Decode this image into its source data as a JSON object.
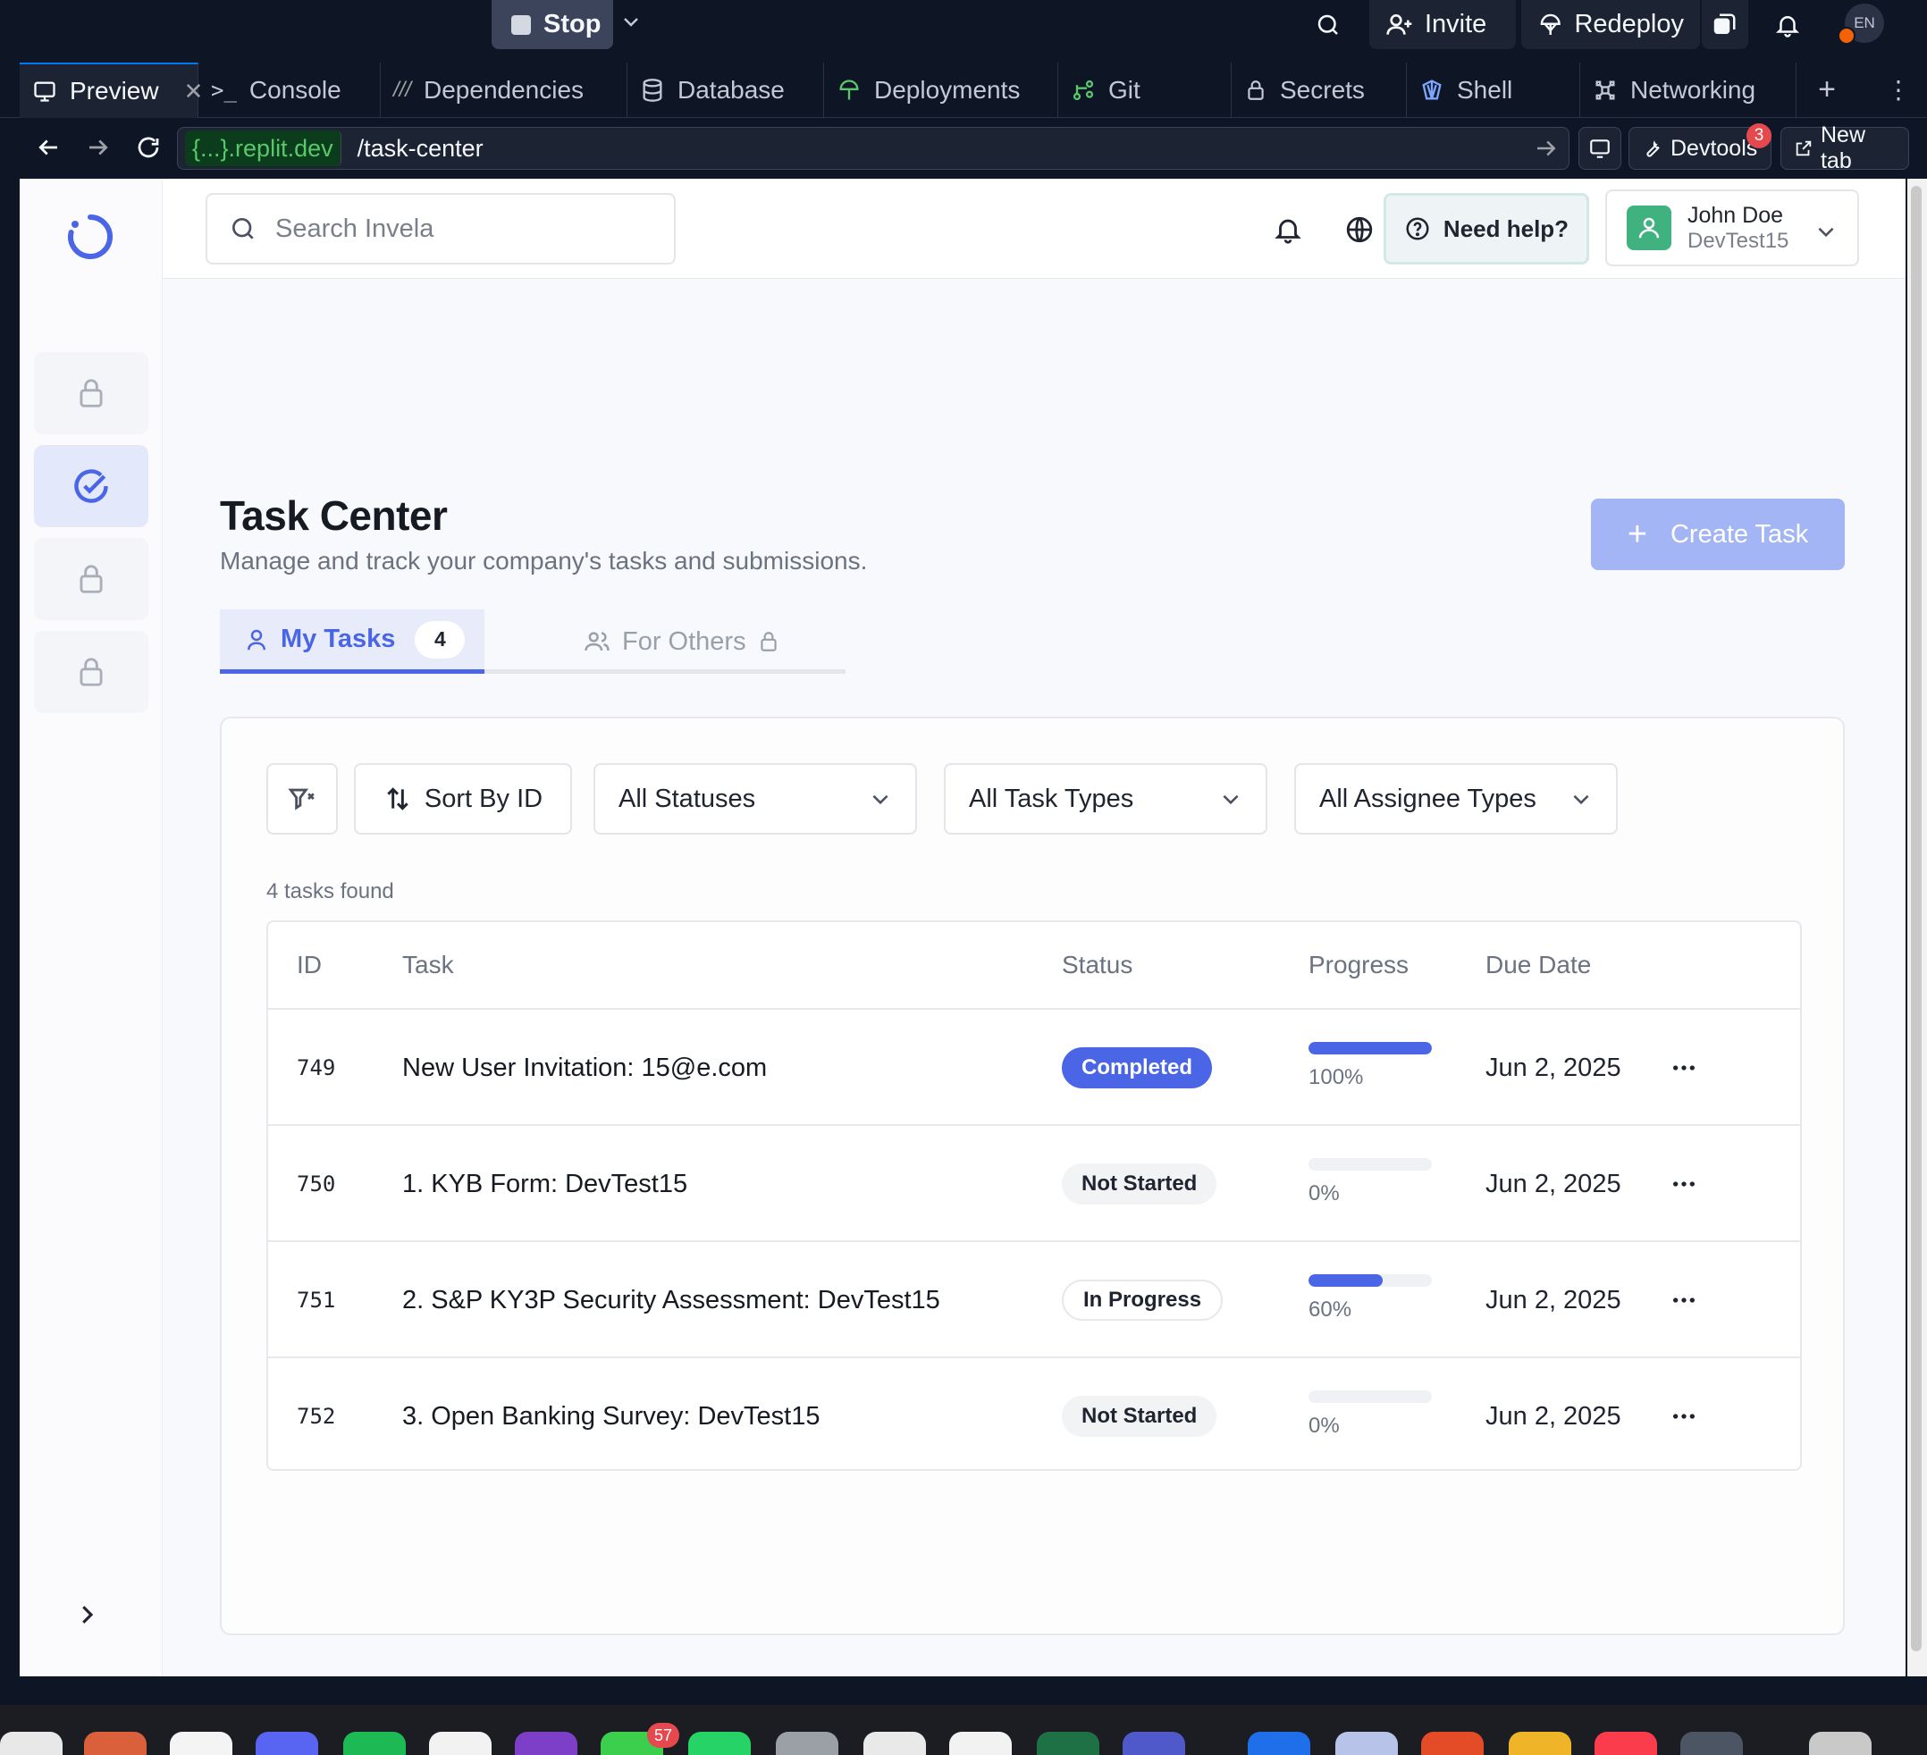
{
  "replit": {
    "stop_label": "Stop",
    "invite_label": "Invite",
    "redeploy_label": "Redeploy",
    "avatar_initials": "EN",
    "tabs": [
      {
        "label": "Preview",
        "icon": "monitor-icon",
        "active": true
      },
      {
        "label": "Console",
        "icon": "terminal-icon"
      },
      {
        "label": "Dependencies",
        "icon": "dependencies-icon"
      },
      {
        "label": "Database",
        "icon": "database-icon"
      },
      {
        "label": "Deployments",
        "icon": "deployments-icon"
      },
      {
        "label": "Git",
        "icon": "git-icon"
      },
      {
        "label": "Secrets",
        "icon": "lock-icon"
      },
      {
        "label": "Shell",
        "icon": "shell-icon"
      },
      {
        "label": "Networking",
        "icon": "networking-icon"
      }
    ],
    "url_host": "{...}.replit.dev",
    "url_path": "/task-center",
    "devtools_label": "Devtools",
    "devtools_badge": "3",
    "newtab_label": "New tab",
    "dock_badge": "57"
  },
  "header": {
    "search_placeholder": "Search Invela",
    "help_label": "Need help?",
    "user_name": "John Doe",
    "user_org": "DevTest15"
  },
  "page": {
    "title": "Task Center",
    "subtitle": "Manage and track your company's tasks and submissions.",
    "create_label": "Create Task",
    "tab_my_label": "My Tasks",
    "tab_my_count": "4",
    "tab_others_label": "For Others"
  },
  "filters": {
    "sort_label": "Sort By ID",
    "status_select": "All Statuses",
    "type_select": "All Task Types",
    "assignee_select": "All Assignee Types",
    "found_text": "4 tasks found"
  },
  "table": {
    "columns": {
      "id": "ID",
      "task": "Task",
      "status": "Status",
      "progress": "Progress",
      "due": "Due Date"
    },
    "rows": [
      {
        "id": "749",
        "task": "New User Invitation: 15@e.com",
        "status": "Completed",
        "status_style": "completed",
        "progress": 100,
        "progress_label": "100%",
        "due": "Jun 2, 2025"
      },
      {
        "id": "750",
        "task": "1. KYB Form: DevTest15",
        "status": "Not Started",
        "status_style": "notstarted",
        "progress": 0,
        "progress_label": "0%",
        "due": "Jun 2, 2025"
      },
      {
        "id": "751",
        "task": "2. S&P KY3P Security Assessment: DevTest15",
        "status": "In Progress",
        "status_style": "inprogress",
        "progress": 60,
        "progress_label": "60%",
        "due": "Jun 2, 2025"
      },
      {
        "id": "752",
        "task": "3. Open Banking Survey: DevTest15",
        "status": "Not Started",
        "status_style": "notstarted",
        "progress": 0,
        "progress_label": "0%",
        "due": "Jun 2, 2025"
      }
    ]
  },
  "colors": {
    "accent": "#4a66e6",
    "create_button": "#a4b5f6",
    "replit_bg": "#0e1525"
  }
}
